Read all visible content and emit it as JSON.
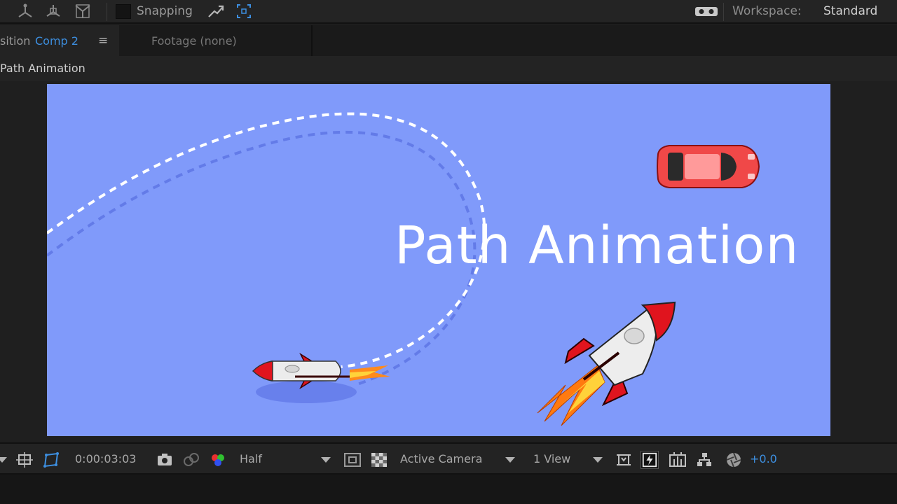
{
  "toolbar": {
    "snapping_label": "Snapping",
    "workspace_label": "Workspace:",
    "workspace_value": "Standard",
    "icons": [
      "axis-local-icon",
      "axis-world-icon",
      "axis-view-icon",
      "snap-feather-icon",
      "snap-grid-icon",
      "vr-goggles-icon"
    ]
  },
  "tabs": {
    "composition_prefix": "sition",
    "composition_name": "Comp 2",
    "menu_glyph": "≡",
    "footage_label": "Footage (none)"
  },
  "breadcrumb": {
    "label": "Path Animation"
  },
  "canvas": {
    "background": "#809afa",
    "title": "Path Animation"
  },
  "viewer_controls": {
    "timecode": "0:00:03:03",
    "resolution": "Half",
    "camera": "Active Camera",
    "views": "1 View",
    "exposure": "+0.0",
    "icons": [
      "region-of-interest-icon",
      "toggle-transparency-grid-icon",
      "snapshot-icon",
      "show-snapshot-icon",
      "channel-rgb-icon",
      "fast-preview-icon",
      "timeline-icon",
      "comp-flowchart-icon",
      "reset-exposure-icon"
    ]
  },
  "colors": {
    "accent_blue": "#3d8fe0",
    "panel_bg": "#232323",
    "rocket_red": "#e0141e",
    "car_red": "#f04848"
  }
}
